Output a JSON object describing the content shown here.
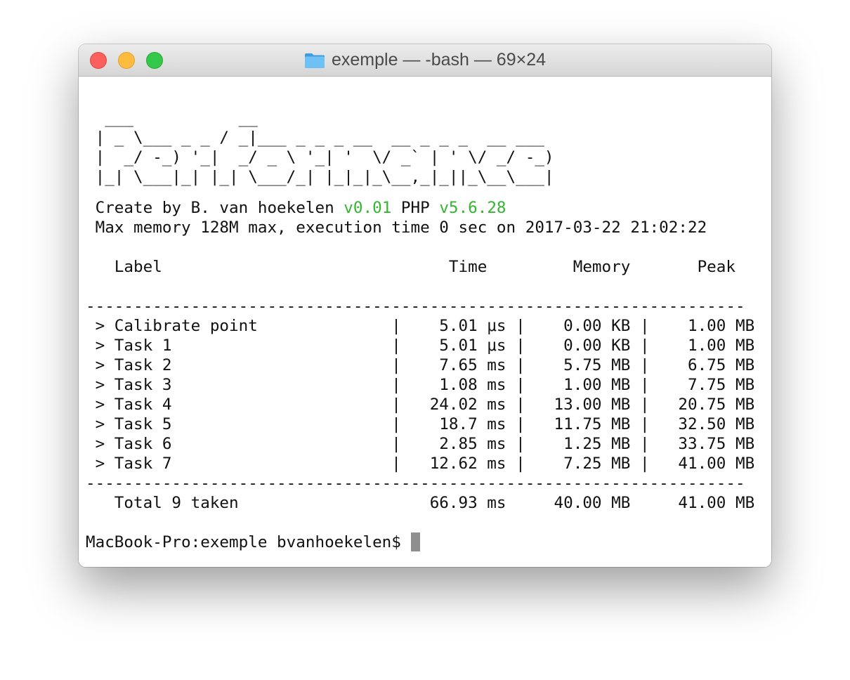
{
  "window": {
    "title": "exemple — -bash — 69×24",
    "folder_icon": "folder-icon",
    "folder_color": "#4aa7e8"
  },
  "terminal": {
    "banner": [
      "  ___           __",
      " | _ \\___ _ _ / _|___ _ _ _ __  __ _ _ _  __ ___",
      " |  _/ -_) '_|  _/ _ \\ '_| '  \\/ _` | ' \\/ _/ -_)",
      " |_| \\___|_| |_| \\___/_| |_|_|_\\__,_|_||_\\__\\___|"
    ],
    "info": {
      "created_prefix": " Create by B. van hoekelen ",
      "version": "v0.01",
      "php_label": " PHP ",
      "php_version": "v5.6.28",
      "memory_line": " Max memory 128M max, execution time 0 sec on 2017-03-22 21:02:22"
    },
    "header_line": "   Label                              Time         Memory       Peak",
    "separator": "---------------------------------------------------------------------",
    "rows": [
      " > Calibrate point              |    5.01 μs |    0.00 KB |    1.00 MB",
      " > Task 1                       |    5.01 μs |    0.00 KB |    1.00 MB",
      " > Task 2                       |    7.65 ms |    5.75 MB |    6.75 MB",
      " > Task 3                       |    1.08 ms |    1.00 MB |    7.75 MB",
      " > Task 4                       |   24.02 ms |   13.00 MB |   20.75 MB",
      " > Task 5                       |    18.7 ms |   11.75 MB |   32.50 MB",
      " > Task 6                       |    2.85 ms |    1.25 MB |   33.75 MB",
      " > Task 7                       |   12.62 ms |    7.25 MB |   41.00 MB"
    ],
    "total_line": "   Total 9 taken                    66.93 ms     40.00 MB     41.00 MB",
    "prompt": "MacBook-Pro:exemple bvanhoekelen$ ",
    "accent_color": "#34b531",
    "cursor_color": "#8e8e8e"
  }
}
